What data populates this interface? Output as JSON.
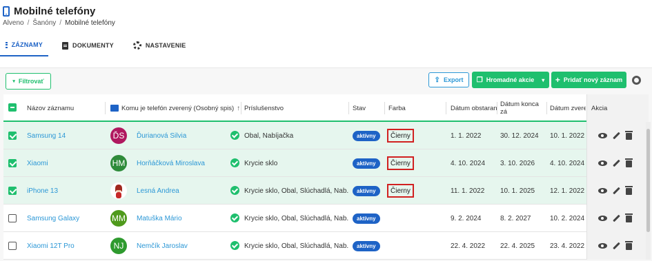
{
  "page": {
    "title": "Mobilné telefóny",
    "breadcrumb": [
      "Alveno",
      "Šanóny",
      "Mobilné telefóny"
    ]
  },
  "tabs": [
    {
      "label": "ZÁZNAMY",
      "active": true,
      "icon": "list-icon"
    },
    {
      "label": "DOKUMENTY",
      "active": false,
      "icon": "document-icon"
    },
    {
      "label": "NASTAVENIE",
      "active": false,
      "icon": "gear-icon"
    }
  ],
  "toolbar": {
    "filter_label": "Filtrovať",
    "export_label": "Export",
    "bulk_label": "Hromadné akcie",
    "add_label": "Pridať nový záznam"
  },
  "colors": {
    "green": "#1fbf6e",
    "blue": "#1e63c6",
    "link": "#2b97d6",
    "highlight": "#d12020"
  },
  "table": {
    "columns": [
      "Názov záznamu",
      "Komu je telefón zverený (Osobný spis)",
      "Príslušenstvo",
      "Stav",
      "Farba",
      "Dátum obstaran",
      "Dátum konca zá",
      "Dátum zveren",
      "Akcia"
    ],
    "rows": [
      {
        "selected": true,
        "name": "Samsung 14",
        "person": "Ďurianová Silvia",
        "initials": "ĎS",
        "avatar_color": "#b0185f",
        "accessories": "Obal, Nabíjačka",
        "status": "aktívny",
        "color": "Čierny",
        "d1": "1. 1. 2022",
        "d2": "30. 12. 2024",
        "d3": "10. 1. 2022"
      },
      {
        "selected": true,
        "name": "Xiaomi",
        "person": "Horňáčková Miroslava",
        "initials": "HM",
        "avatar_color": "#2e8b3a",
        "accessories": "Krycie sklo",
        "status": "aktívny",
        "color": "Čierny",
        "d1": "4. 10. 2024",
        "d2": "3. 10. 2026",
        "d3": "4. 10. 2024"
      },
      {
        "selected": true,
        "name": "iPhone 13",
        "person": "Lesná Andrea",
        "initials": "",
        "avatar_color": "#ffffff",
        "accessories": "Krycie sklo, Obal, Slúchadlá, Nab...",
        "status": "aktívny",
        "color": "Čierny",
        "d1": "11. 1. 2022",
        "d2": "10. 1. 2025",
        "d3": "12. 1. 2022"
      },
      {
        "selected": false,
        "name": "Samsung Galaxy",
        "person": "Matuška Mário",
        "initials": "MM",
        "avatar_color": "#4f9a1c",
        "accessories": "Krycie sklo, Obal, Slúchadlá, Nab...",
        "status": "aktívny",
        "color": "",
        "d1": "9. 2. 2024",
        "d2": "8. 2. 2027",
        "d3": "10. 2. 2024"
      },
      {
        "selected": false,
        "name": "Xiaomi 12T Pro",
        "person": "Nemčík Jaroslav",
        "initials": "NJ",
        "avatar_color": "#2e9a2e",
        "accessories": "Krycie sklo, Obal, Slúchadlá, Nab...",
        "status": "aktívny",
        "color": "",
        "d1": "22. 4. 2022",
        "d2": "22. 4. 2025",
        "d3": "23. 4. 2022"
      }
    ]
  }
}
